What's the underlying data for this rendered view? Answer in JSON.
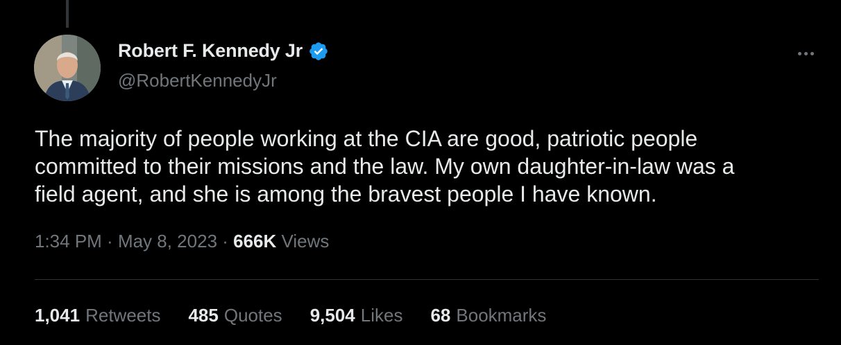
{
  "author": {
    "display_name": "Robert F. Kennedy Jr",
    "handle": "@RobertKennedyJr",
    "verified": true,
    "verified_color": "#1d9bf0"
  },
  "tweet": {
    "text": "The majority of people working at the CIA are good, patriotic people\ncommitted to their missions and the law. My own daughter-in-law was a\nfield agent, and she is among the bravest people I have known."
  },
  "meta": {
    "time": "1:34 PM",
    "separator": " · ",
    "date": "May 8, 2023",
    "views_count": "666K",
    "views_label": " Views"
  },
  "stats": [
    {
      "count": "1,041",
      "label": "Retweets"
    },
    {
      "count": "485",
      "label": "Quotes"
    },
    {
      "count": "9,504",
      "label": "Likes"
    },
    {
      "count": "68",
      "label": "Bookmarks"
    }
  ],
  "icons": {
    "verified": "verified-badge-icon",
    "more": "more-options-icon"
  },
  "colors": {
    "background": "#000000",
    "primary_text": "#e7e9ea",
    "secondary_text": "#71767b",
    "divider": "#2f3336"
  }
}
